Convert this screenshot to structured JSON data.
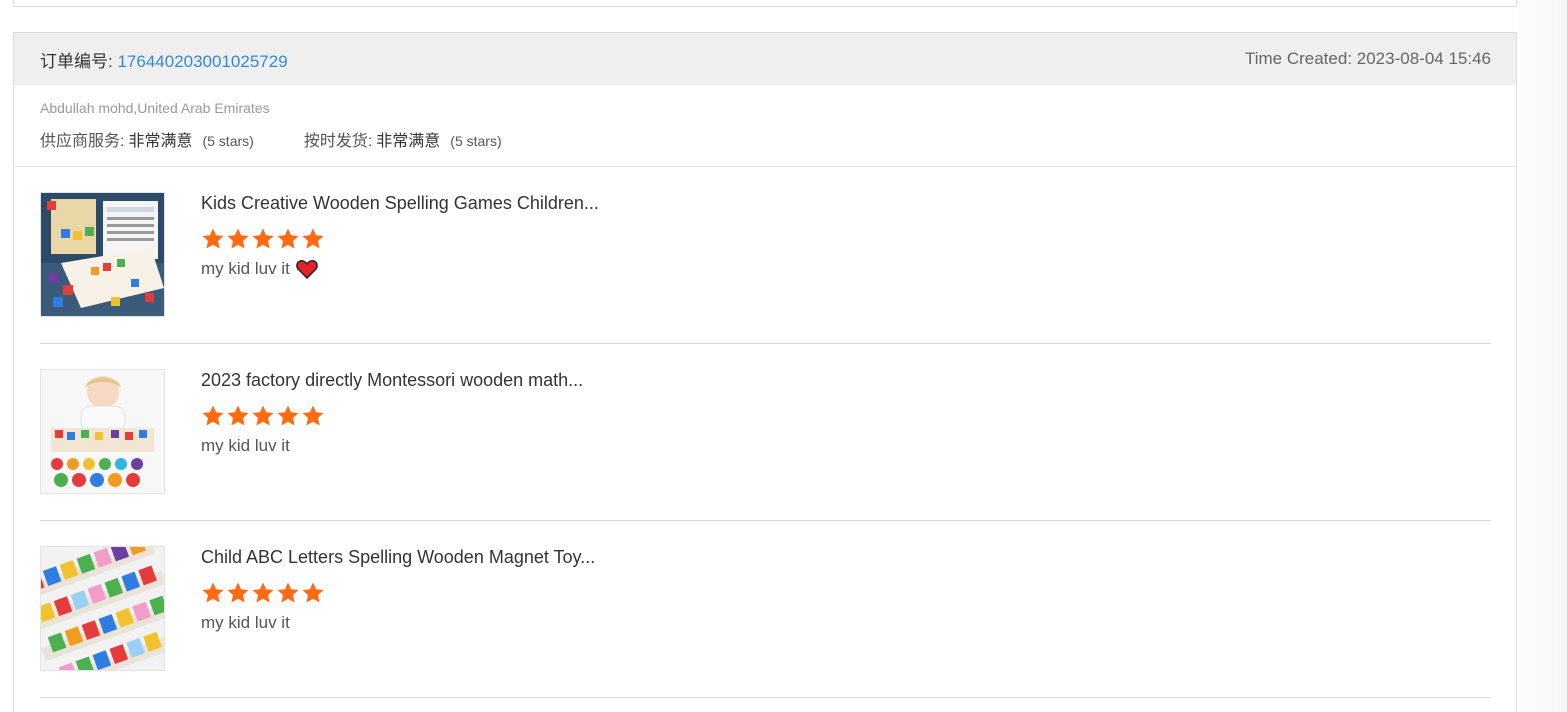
{
  "order": {
    "number_label": "订单编号:",
    "number_value": "176440203001025729",
    "time_created": "Time Created: 2023-08-04 15:46"
  },
  "buyer": {
    "name": "Abdullah mohd,United Arab Emirates",
    "supplier_service_label": "供应商服务:",
    "supplier_service_value": "非常满意",
    "supplier_service_stars": "(5 stars)",
    "ontime_shipping_label": "按时发货:",
    "ontime_shipping_value": "非常满意",
    "ontime_shipping_stars": "(5 stars)"
  },
  "products": [
    {
      "title": "Kids Creative Wooden Spelling Games Children...",
      "rating": 5,
      "review": "my kid luv it",
      "has_heart": true
    },
    {
      "title": "2023 factory directly Montessori wooden math...",
      "rating": 5,
      "review": "my kid luv it",
      "has_heart": false
    },
    {
      "title": "Child ABC Letters Spelling Wooden Magnet Toy...",
      "rating": 5,
      "review": "my kid luv it",
      "has_heart": false
    }
  ],
  "colors": {
    "star": "#ff6a13",
    "link": "#2f8ad3",
    "heart": "#e8202a"
  },
  "icons": {
    "star": "star-icon",
    "heart": "heart-icon"
  }
}
